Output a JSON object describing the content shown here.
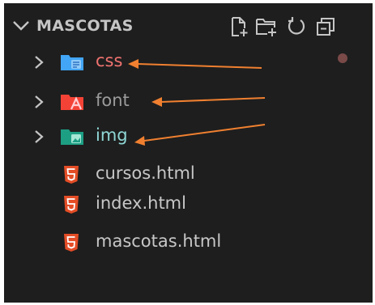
{
  "explorer": {
    "section_title": "MASCOTAS",
    "toolbar": [
      {
        "icon": "new-file-icon"
      },
      {
        "icon": "new-folder-icon"
      },
      {
        "icon": "refresh-icon"
      },
      {
        "icon": "collapse-all-icon"
      }
    ],
    "folders": [
      {
        "label": "css",
        "icon": "folder-css-icon",
        "color": "#f07370"
      },
      {
        "label": "font",
        "icon": "folder-font-icon",
        "color": "#9b9b9b"
      },
      {
        "label": "img",
        "icon": "folder-images-icon",
        "color": "#8fd7d5"
      }
    ],
    "files": [
      {
        "label": "cursos.html",
        "icon": "html5-icon"
      },
      {
        "label": "index.html",
        "icon": "html5-icon"
      },
      {
        "label": "mascotas.html",
        "icon": "html5-icon"
      }
    ]
  },
  "annotations": {
    "arrow_color": "#f08030",
    "arrows": [
      {
        "points_to": "css"
      },
      {
        "points_to": "font"
      },
      {
        "points_to": "img"
      }
    ]
  },
  "colors": {
    "background": "#1e1e1e",
    "html_icon": "#e44d26",
    "dot": "#7a4a48"
  }
}
